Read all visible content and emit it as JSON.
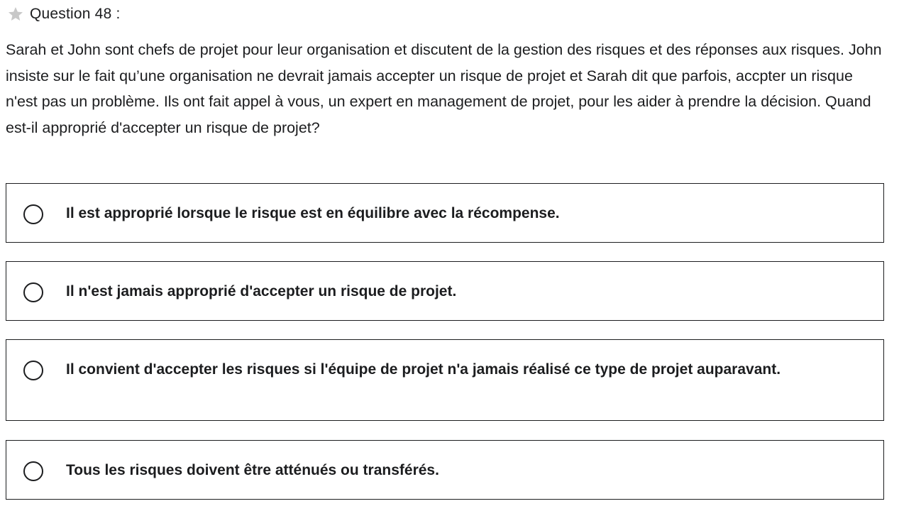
{
  "question": {
    "number_label": "Question 48 :",
    "text": "Sarah et John sont chefs de projet pour leur organisation et discutent de la gestion des risques et des réponses aux risques. John insiste sur le fait qu’une organisation ne devrait jamais accepter un risque de projet et Sarah dit que parfois, accpter un risque n'est pas un problème. Ils ont fait appel à vous, un expert en management de projet, pour les aider à prendre la décision. Quand est-il approprié d'accepter un risque de projet?",
    "star_icon": "star-icon",
    "star_color": "#c8c8c8"
  },
  "answers": [
    {
      "label": "Il est approprié lorsque le risque est en équilibre avec la récompense.",
      "selected": false
    },
    {
      "label": "Il n'est jamais approprié d'accepter un risque de projet.",
      "selected": false
    },
    {
      "label": "Il convient d'accepter les risques si l'équipe de projet n'a jamais réalisé ce type de projet auparavant.",
      "selected": false
    },
    {
      "label": "Tous les risques doivent être atténués ou transférés.",
      "selected": false
    }
  ]
}
